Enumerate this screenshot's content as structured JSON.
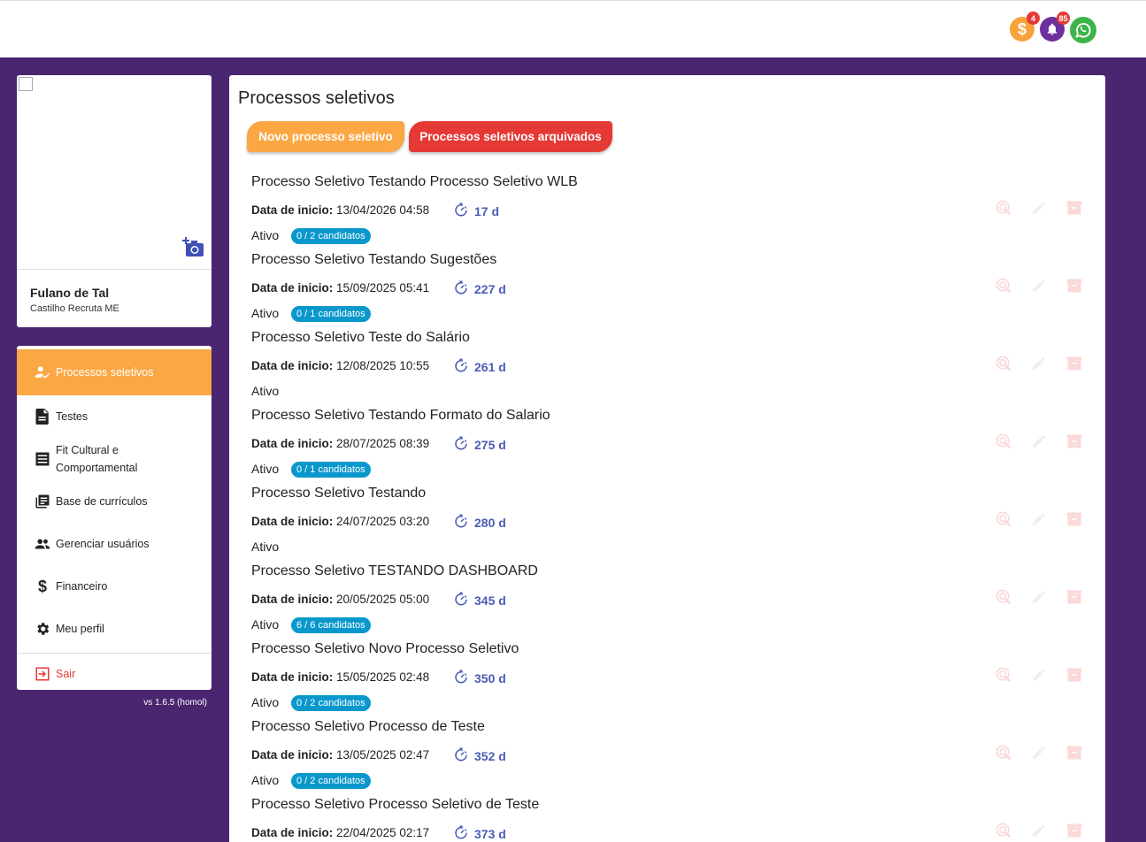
{
  "topbar": {
    "money_badge": "4",
    "bell_badge": "85"
  },
  "profile": {
    "name": "Fulano de Tal",
    "company": "Castilho Recruta ME"
  },
  "menu": {
    "items": [
      {
        "label": "Processos seletivos",
        "icon": "user-check-icon"
      },
      {
        "label": "Testes",
        "icon": "document-icon"
      },
      {
        "label": "Fit Cultural e Comportamental",
        "icon": "list-icon"
      },
      {
        "label": "Base de currículos",
        "icon": "library-icon"
      },
      {
        "label": "Gerenciar usuários",
        "icon": "users-icon"
      },
      {
        "label": "Financeiro",
        "icon": "dollar-icon"
      },
      {
        "label": "Meu perfil",
        "icon": "gear-icon"
      }
    ],
    "logout": "Sair",
    "version": "vs 1.6.5 (homol)"
  },
  "main": {
    "title": "Processos seletivos",
    "new_button": "Novo processo seletivo",
    "archived_button": "Processos seletivos arquivados",
    "date_label": "Data de inicio:",
    "processes": [
      {
        "title": "Processo Seletivo Testando Processo Seletivo WLB",
        "date": "13/04/2026 04:58",
        "days": "17 d",
        "status": "Ativo",
        "badge": "0 / 2 candidatos"
      },
      {
        "title": "Processo Seletivo Testando Sugestões",
        "date": "15/09/2025 05:41",
        "days": "227 d",
        "status": "Ativo",
        "badge": "0 / 1 candidatos"
      },
      {
        "title": "Processo Seletivo Teste do Salário",
        "date": "12/08/2025 10:55",
        "days": "261 d",
        "status": "Ativo",
        "badge": ""
      },
      {
        "title": "Processo Seletivo Testando Formato do Salario",
        "date": "28/07/2025 08:39",
        "days": "275 d",
        "status": "Ativo",
        "badge": "0 / 1 candidatos"
      },
      {
        "title": "Processo Seletivo Testando",
        "date": "24/07/2025 03:20",
        "days": "280 d",
        "status": "Ativo",
        "badge": ""
      },
      {
        "title": "Processo Seletivo TESTANDO DASHBOARD",
        "date": "20/05/2025 05:00",
        "days": "345 d",
        "status": "Ativo",
        "badge": "6 / 6 candidatos"
      },
      {
        "title": "Processo Seletivo Novo Processo Seletivo",
        "date": "15/05/2025 02:48",
        "days": "350 d",
        "status": "Ativo",
        "badge": "0 / 2 candidatos"
      },
      {
        "title": "Processo Seletivo Processo de Teste",
        "date": "13/05/2025 02:47",
        "days": "352 d",
        "status": "Ativo",
        "badge": "0 / 2 candidatos"
      },
      {
        "title": "Processo Seletivo Processo Seletivo de Teste",
        "date": "22/04/2025 02:17",
        "days": "373 d",
        "status": "",
        "badge": ""
      }
    ]
  },
  "colors": {
    "purple_bg": "#4a2570",
    "orange": "#fba743",
    "red": "#e53935",
    "badge_blue": "#0a98cc",
    "days_blue": "#4a5bb5"
  }
}
